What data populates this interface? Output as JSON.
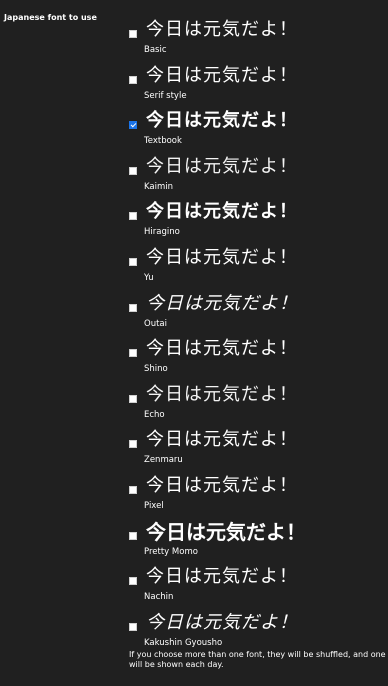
{
  "setting": {
    "label": "Japanese font to use",
    "hint": "If you choose more than one font, they will be shuffled, and one will be shown each day."
  },
  "sample_text": "今日は元気だよ！",
  "fonts": [
    {
      "name": "Basic",
      "checked": false
    },
    {
      "name": "Serif style",
      "checked": false
    },
    {
      "name": "Textbook",
      "checked": true
    },
    {
      "name": "Kaimin",
      "checked": false
    },
    {
      "name": "Hiragino",
      "checked": false
    },
    {
      "name": "Yu",
      "checked": false
    },
    {
      "name": "Outai",
      "checked": false
    },
    {
      "name": "Shino",
      "checked": false
    },
    {
      "name": "Echo",
      "checked": false
    },
    {
      "name": "Zenmaru",
      "checked": false
    },
    {
      "name": "Pixel",
      "checked": false
    },
    {
      "name": "Pretty Momo",
      "checked": false
    },
    {
      "name": "Nachin",
      "checked": false
    },
    {
      "name": "Kakushin Gyousho",
      "checked": false
    }
  ],
  "colors": {
    "background": "#202020",
    "text": "#ffffff",
    "checkbox_checked": "#1a73e8"
  }
}
